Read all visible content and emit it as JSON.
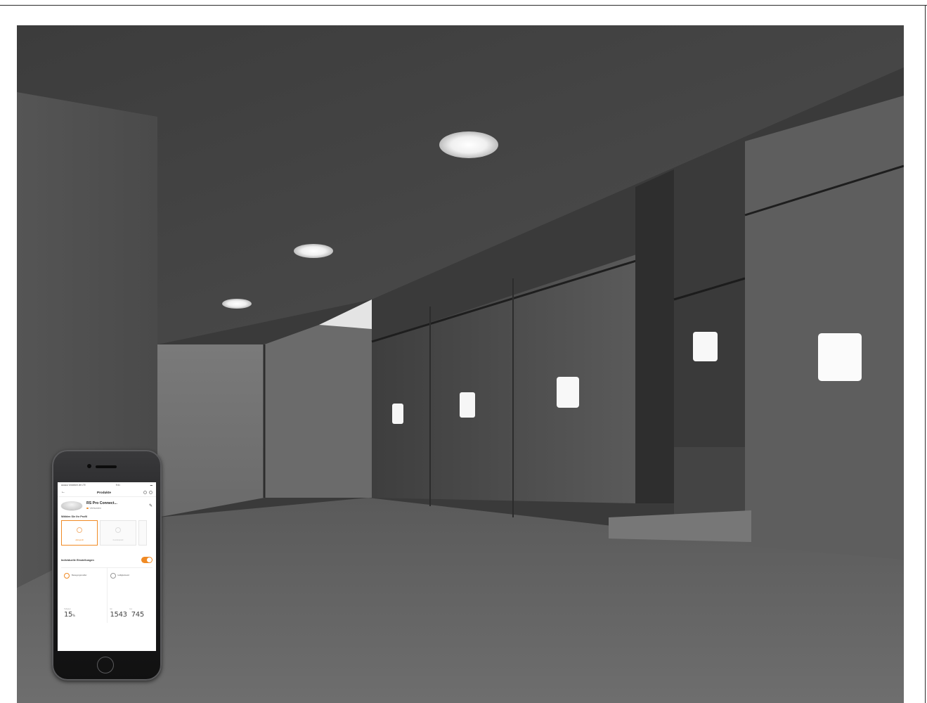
{
  "scene": {
    "description_icons": [
      "ceiling-light-icon",
      "wall-light-icon",
      "smartphone-icon"
    ],
    "colors": {
      "accent": "#f08a24",
      "concrete": "#4a4a4a"
    }
  },
  "phone": {
    "statusbar": {
      "carrier": "●●●●● Vodafone.de LTE",
      "time": "9:41",
      "battery": "▬"
    },
    "nav": {
      "back": "←",
      "title": "Produkte"
    },
    "product": {
      "name": "RS Pro Connect...",
      "status": "Verbunden",
      "edit": "✎"
    },
    "profile_section_label": "Wählen Sie Ihr Profil",
    "profiles": [
      {
        "label": "Aktivprofil"
      },
      {
        "label": "Komfortprofil"
      }
    ],
    "toggle_label": "Individuelle Einstellungen",
    "settings": [
      {
        "name": "Bewegungsmelder",
        "caption": "Helligkeit",
        "value": "15",
        "unit": "%"
      },
      {
        "name": "Helligkeitswert",
        "captions": [
          "Ein",
          "Aus"
        ],
        "values": [
          "1543",
          "745"
        ]
      }
    ]
  }
}
